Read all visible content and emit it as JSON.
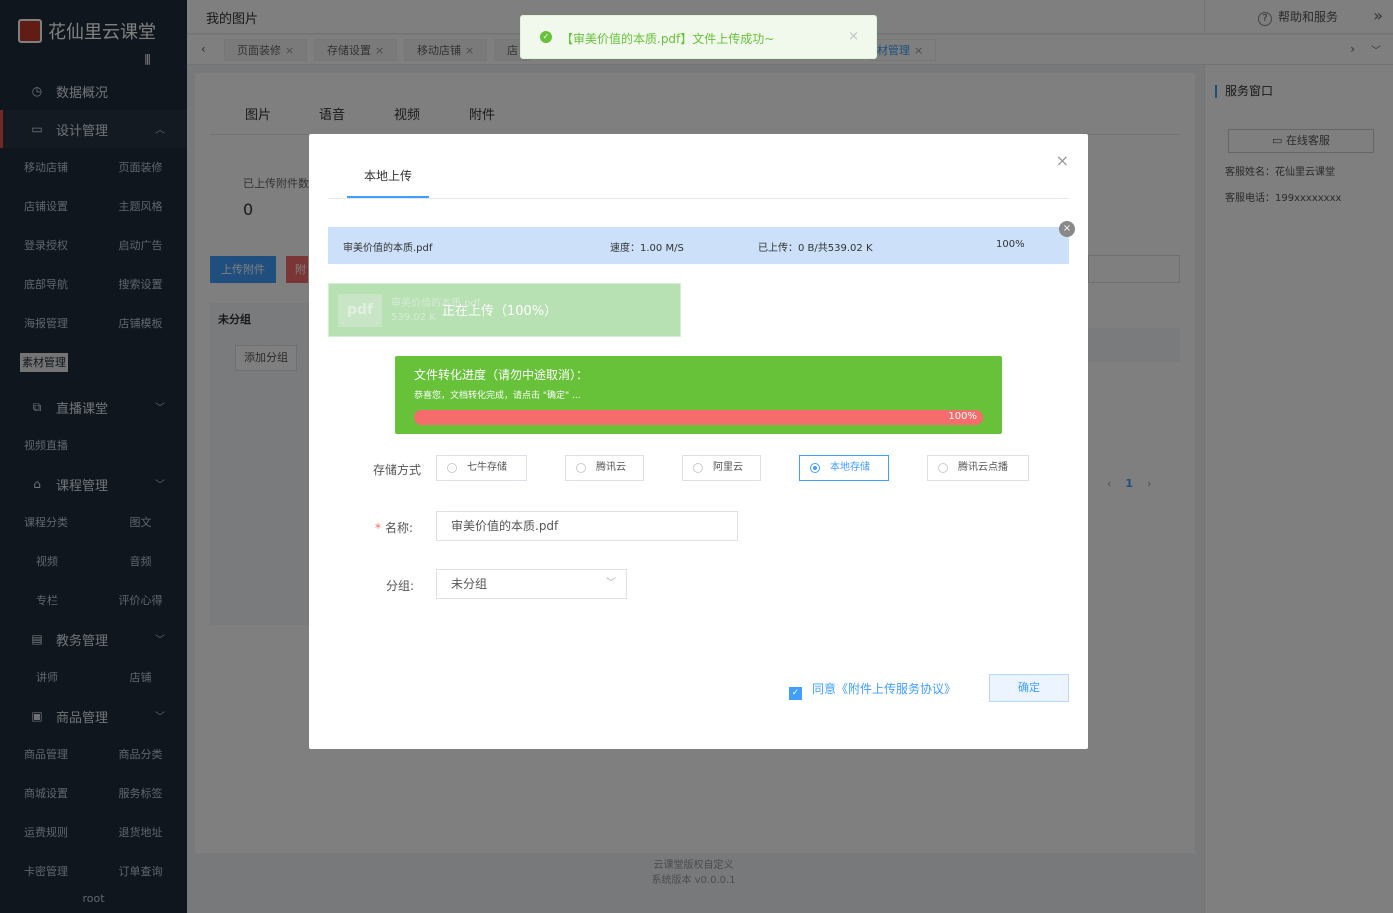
{
  "app": {
    "name": "花仙里云课堂",
    "user": "root"
  },
  "sidebar": {
    "sections": [
      {
        "label": "数据概况",
        "icon": "clock-icon",
        "items": []
      },
      {
        "label": "设计管理",
        "icon": "monitor-icon",
        "items": [
          "移动店铺",
          "页面装修",
          "店铺设置",
          "主题风格",
          "登录授权",
          "启动广告",
          "底部导航",
          "搜索设置",
          "海报管理",
          "店铺模板",
          "素材管理"
        ]
      },
      {
        "label": "直播课堂",
        "icon": "live-icon",
        "items": [
          "视频直播"
        ]
      },
      {
        "label": "课程管理",
        "icon": "cap-icon",
        "items": [
          "课程分类",
          "图文",
          "视频",
          "音频",
          "专栏",
          "评价心得"
        ]
      },
      {
        "label": "教务管理",
        "icon": "book-icon",
        "items": [
          "讲师",
          "店铺"
        ]
      },
      {
        "label": "商品管理",
        "icon": "goods-icon",
        "items": [
          "商品管理",
          "商品分类",
          "商城设置",
          "服务标签",
          "运费规则",
          "退货地址",
          "卡密管理",
          "订单查询"
        ]
      }
    ]
  },
  "topbar": {
    "title": "我的图片",
    "help": "帮助和服务"
  },
  "tabs": [
    "页面装修",
    "存储设置",
    "移动店铺",
    "店",
    "材管理"
  ],
  "main": {
    "tabs": [
      "图片",
      "语音",
      "视频",
      "附件"
    ],
    "stat_label": "已上传附件数",
    "stat_value": "0",
    "upload_btn": "上传附件",
    "red_btn": "附",
    "group_head": "未分组",
    "add_group": "添加分组",
    "page": "1"
  },
  "footer": {
    "line1": "云课堂版权自定义",
    "line2": "系统版本 v0.0.0.1"
  },
  "service": {
    "title": "服务窗口",
    "button": "在线客服",
    "name": "客服姓名：花仙里云课堂",
    "phone": "客服电话：199xxxxxxxx"
  },
  "toast": {
    "text": "【审美价值的本质.pdf】文件上传成功~"
  },
  "dialog": {
    "tab": "本地上传",
    "file": {
      "name": "审美价值的本质.pdf",
      "speed": "速度：1.00 M/S",
      "uploaded": "已上传：0 B/共539.02 K",
      "percent": "100%"
    },
    "uploading": {
      "icon_text": "pdf",
      "name": "审美价值的本质.pdf",
      "size": "539.02 K",
      "text": "正在上传（100%）"
    },
    "convert": {
      "title": "文件转化进度（请勿中途取消）：",
      "sub": "恭喜您，文档转化完成，请点击 \"确定\" ...",
      "percent": "100%",
      "progress": 1.0
    },
    "storage_label": "存储方式",
    "storage_options": [
      "七牛存储",
      "腾讯云",
      "阿里云",
      "本地存储",
      "腾讯云点播"
    ],
    "storage_selected": "本地存储",
    "name_label": "名称:",
    "name_value": "审美价值的本质.pdf",
    "group_label": "分组:",
    "group_value": "未分组",
    "agree_prefix": "同意",
    "agree_link": "《附件上传服务协议》",
    "ok": "确定"
  }
}
